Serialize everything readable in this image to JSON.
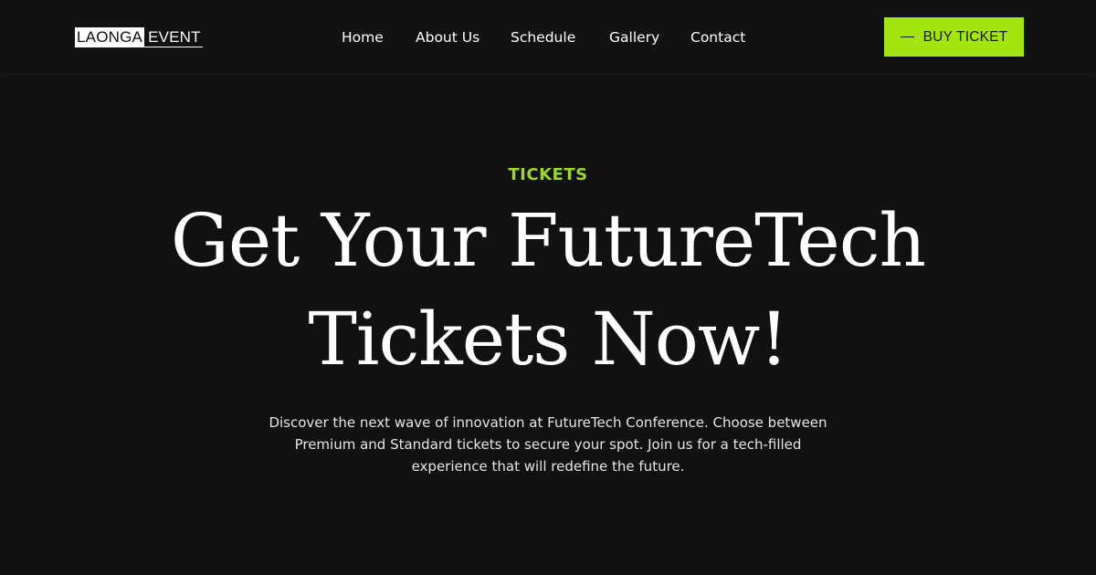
{
  "header": {
    "logo": {
      "part1": "LAONGA",
      "part2": "EVENT"
    },
    "nav": [
      {
        "label": "Home"
      },
      {
        "label": "About Us"
      },
      {
        "label": "Schedule"
      },
      {
        "label": "Gallery"
      },
      {
        "label": "Contact"
      }
    ],
    "cta": {
      "label": "BUY TICKET",
      "icon": "dash-icon"
    }
  },
  "hero": {
    "eyebrow": "TICKETS",
    "headline_line1": "Get Your FutureTech",
    "headline_line2": "Tickets Now!",
    "description": "Discover the next wave of innovation at FutureTech Conference. Choose between Premium and Standard tickets to secure your spot. Join us for a tech-filled experience that will redefine the future."
  },
  "colors": {
    "background": "#111111",
    "accent": "#a3e60f",
    "eyebrow": "#9fd62a",
    "text": "#ffffff"
  }
}
